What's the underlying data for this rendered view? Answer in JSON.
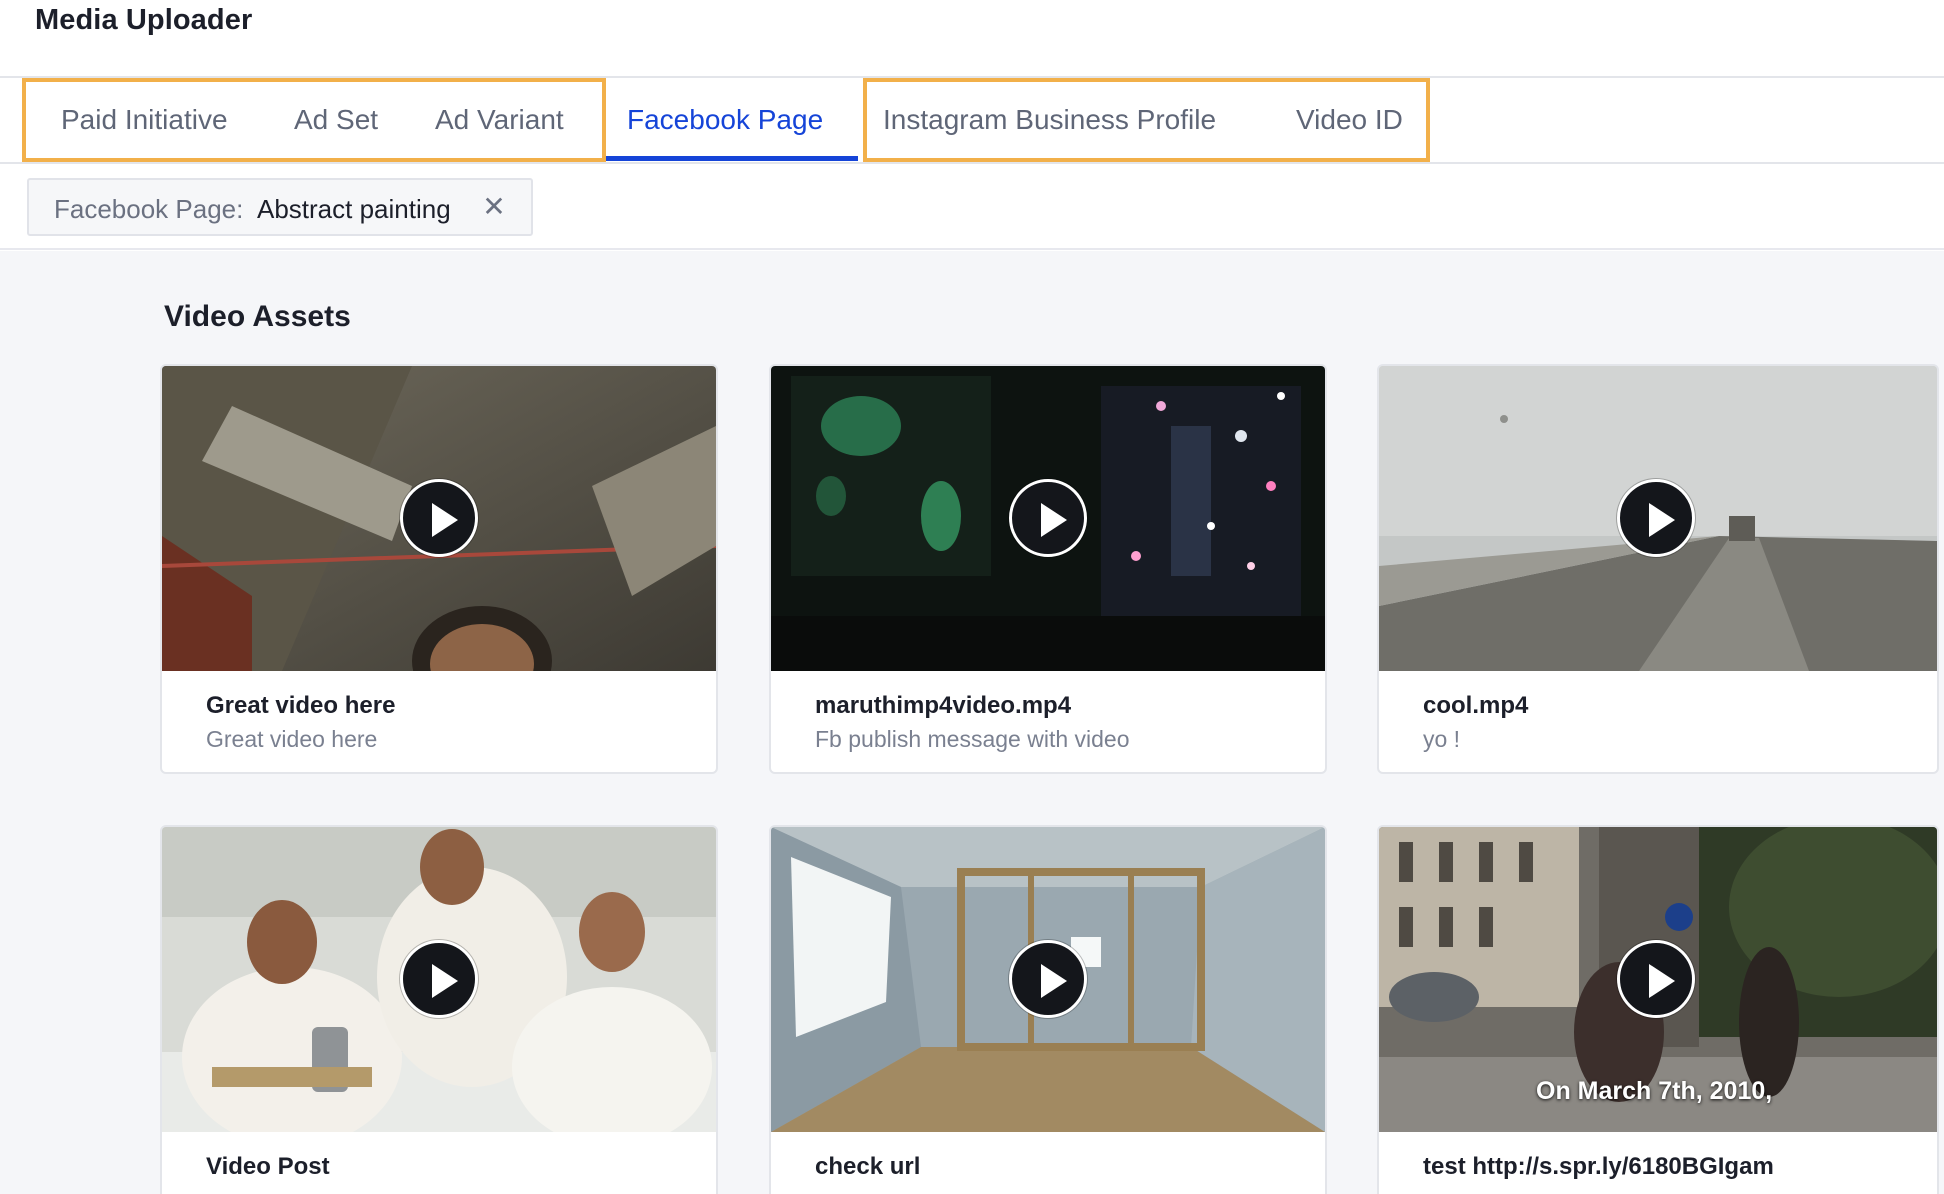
{
  "app": {
    "title": "Media Uploader"
  },
  "tabs": [
    {
      "label": "Paid Initiative",
      "active": false
    },
    {
      "label": "Ad Set",
      "active": false
    },
    {
      "label": "Ad Variant",
      "active": false
    },
    {
      "label": "Facebook Page",
      "active": true
    },
    {
      "label": "Instagram Business Profile",
      "active": false
    },
    {
      "label": "Video ID",
      "active": false
    }
  ],
  "filter": {
    "label": "Facebook Page:",
    "value": "Abstract painting",
    "close_icon": "close-icon"
  },
  "section": {
    "title": "Video Assets"
  },
  "videos": [
    {
      "title": "Great video here",
      "subtitle": "Great video here",
      "icon": "play-icon"
    },
    {
      "title": "maruthimp4video.mp4",
      "subtitle": "Fb publish message with video",
      "icon": "play-icon"
    },
    {
      "title": "cool.mp4",
      "subtitle": "yo !",
      "icon": "play-icon"
    },
    {
      "title": "Video Post",
      "subtitle": "",
      "icon": "play-icon"
    },
    {
      "title": "check url",
      "subtitle": "",
      "icon": "play-icon"
    },
    {
      "title": "test http://s.spr.ly/6180BGIgam",
      "subtitle": "",
      "icon": "play-icon",
      "overlay": "On March 7th, 2010,"
    }
  ],
  "colors": {
    "accent": "#1544d8",
    "highlight": "#f2b04a",
    "background": "#f5f6f9"
  }
}
